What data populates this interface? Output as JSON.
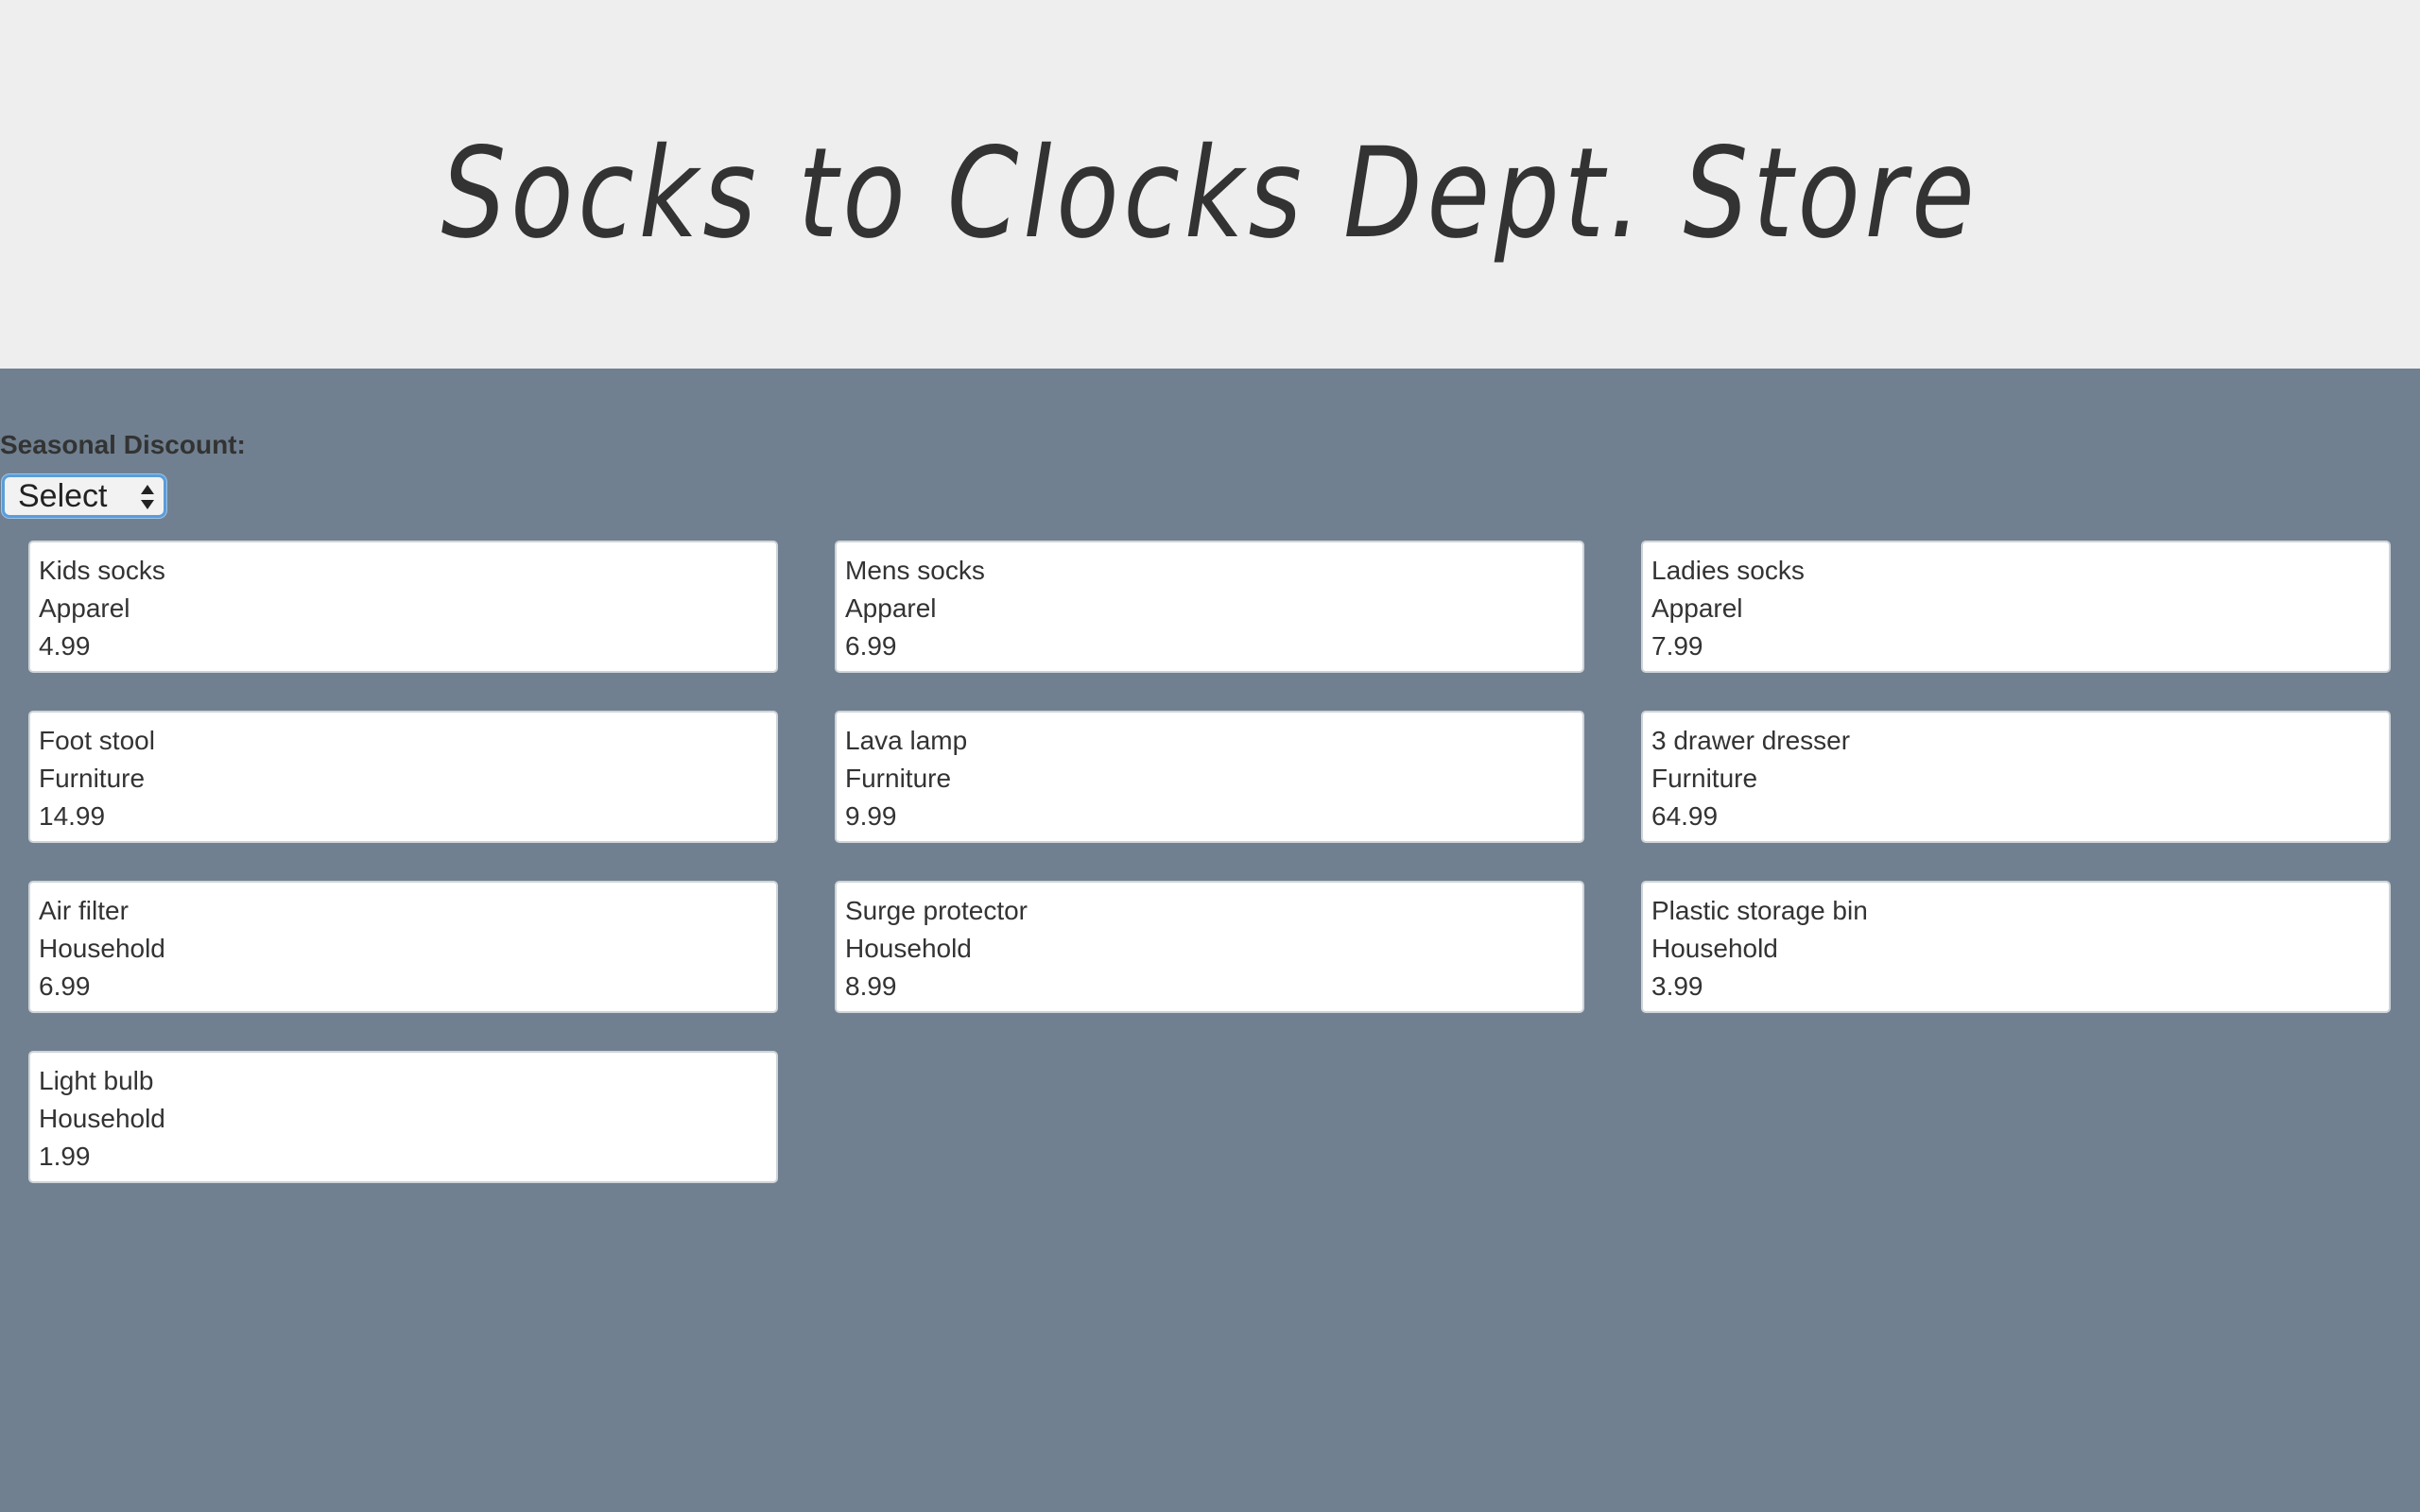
{
  "header": {
    "title": "Socks to Clocks Dept. Store"
  },
  "discount": {
    "label": "Seasonal Discount:",
    "selected": "Select"
  },
  "colors": {
    "header_bg": "#eeeeee",
    "page_bg": "#708090",
    "focus_ring": "#5b9dd9"
  },
  "products": [
    {
      "name": "Kids socks",
      "category": "Apparel",
      "price": "4.99"
    },
    {
      "name": "Mens socks",
      "category": "Apparel",
      "price": "6.99"
    },
    {
      "name": "Ladies socks",
      "category": "Apparel",
      "price": "7.99"
    },
    {
      "name": "Foot stool",
      "category": "Furniture",
      "price": "14.99"
    },
    {
      "name": "Lava lamp",
      "category": "Furniture",
      "price": "9.99"
    },
    {
      "name": "3 drawer dresser",
      "category": "Furniture",
      "price": "64.99"
    },
    {
      "name": "Air filter",
      "category": "Household",
      "price": "6.99"
    },
    {
      "name": "Surge protector",
      "category": "Household",
      "price": "8.99"
    },
    {
      "name": "Plastic storage bin",
      "category": "Household",
      "price": "3.99"
    },
    {
      "name": "Light bulb",
      "category": "Household",
      "price": "1.99"
    }
  ]
}
